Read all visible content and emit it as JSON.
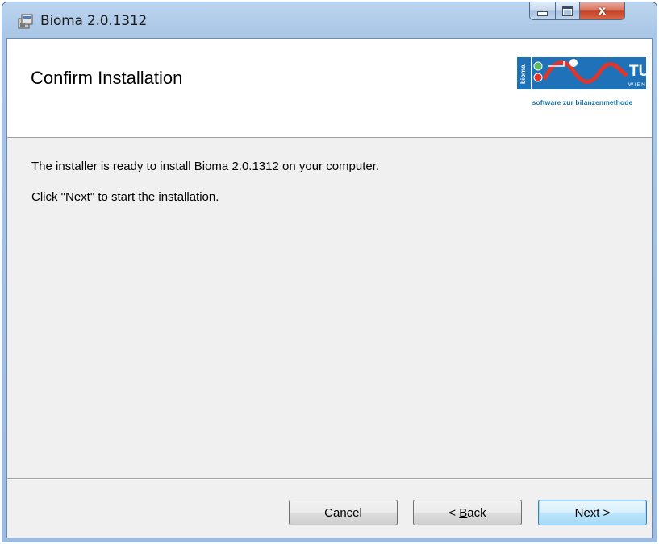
{
  "window": {
    "title": "Bioma 2.0.1312",
    "icon": "installer-package-icon",
    "controls": {
      "minimize": "minimize-icon",
      "maximize": "maximize-icon",
      "close": "x"
    }
  },
  "banner": {
    "title": "Confirm Installation",
    "logo": {
      "side_text": "bioma",
      "tu_text": "TU",
      "wien_text": "WIEN",
      "caption": "software zur bilanzenmethode"
    }
  },
  "content": {
    "line1": "The installer is ready to install Bioma 2.0.1312 on your computer.",
    "line2": "Click \"Next\" to start the installation."
  },
  "buttons": {
    "cancel": "Cancel",
    "back_prefix": "< ",
    "back_access_key": "B",
    "back_rest": "ack",
    "next": "Next >"
  },
  "colors": {
    "accent": "#1d6fa5",
    "close_button": "#c44227",
    "dialog_bg": "#f0f0f0"
  }
}
